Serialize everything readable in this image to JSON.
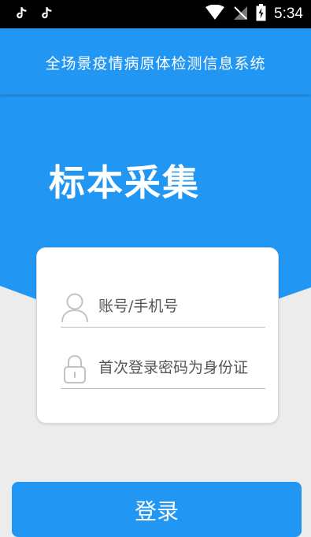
{
  "status_bar": {
    "time": "5:34",
    "icons": [
      "tiktok-icon",
      "tiktok-icon",
      "wifi-icon",
      "no-signal-icon",
      "battery-icon"
    ]
  },
  "header": {
    "title": "全场景疫情病原体检测信息系统"
  },
  "hero": {
    "title": "标本采集"
  },
  "login_form": {
    "account_placeholder": "账号/手机号",
    "password_placeholder": "首次登录密码为身份证",
    "submit_label": "登录"
  },
  "colors": {
    "primary": "#2196f3",
    "background": "#ececec",
    "card": "#ffffff"
  }
}
